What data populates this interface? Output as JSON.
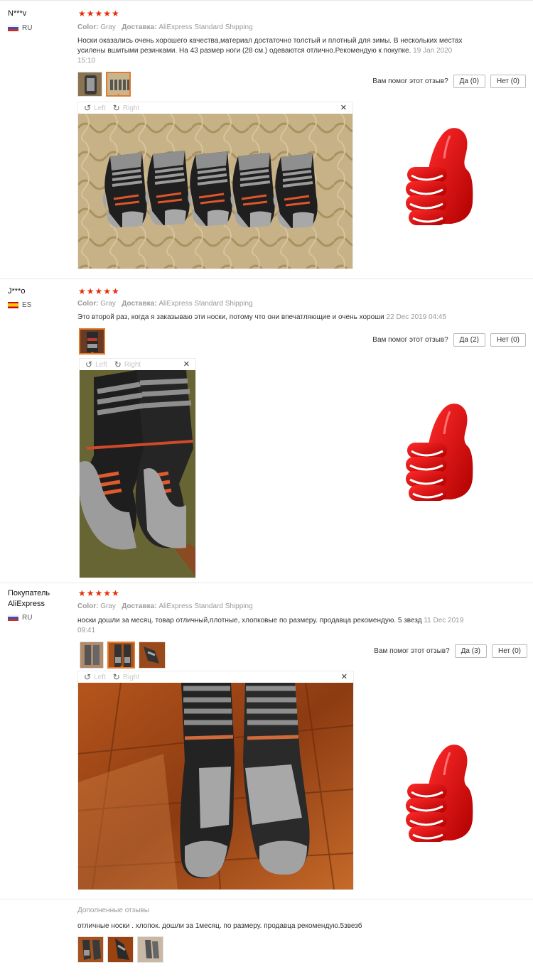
{
  "helpful_label": "Вам помог этот отзыв?",
  "meta_labels": {
    "color": "Color:",
    "delivery": "Доставка:"
  },
  "viewer": {
    "left": "Left",
    "right": "Right",
    "close": "✕"
  },
  "reviews": [
    {
      "user": "N***v",
      "country": "RU",
      "stars": "★★★★★",
      "color": "Gray",
      "delivery": "AliExpress Standard Shipping",
      "text": "Носки оказались очень хорошего качества,материал достаточно толстый и плотный для зимы. В нескольких местах усилены вшитыми резинками. На 43 размер ноги (28 см.) одеваются отлично.Рекомендую к покупке.",
      "date": "19 Jan 2020 15:10",
      "yes": "Да (0)",
      "no": "Нет (0)"
    },
    {
      "user": "J***o",
      "country": "ES",
      "stars": "★★★★★",
      "color": "Gray",
      "delivery": "AliExpress Standard Shipping",
      "text": "Это второй раз, когда я заказываю эти носки, потому что они впечатляющие и очень хороши",
      "date": "22 Dec 2019 04:45",
      "yes": "Да (2)",
      "no": "Нет (0)"
    },
    {
      "user": "Покупатель AliExpress",
      "country": "RU",
      "stars": "★★★★★",
      "color": "Gray",
      "delivery": "AliExpress Standard Shipping",
      "text": "носки дошли за месяц. товар отличный,плотные, хлопковые по размеру. продавца рекомендую. 5 звезд",
      "date": "11 Dec 2019 09:41",
      "yes": "Да (3)",
      "no": "Нет (0)"
    }
  ],
  "additional": {
    "title": "Дополненные отзывы",
    "text": "отличные носки . хлопок. дошли за 1месяц. по размеру. продавца рекомендую.5звезб"
  },
  "colors": {
    "star": "#e62e04",
    "thumb_red": "#d40000",
    "selected_border": "#e27b2c"
  }
}
